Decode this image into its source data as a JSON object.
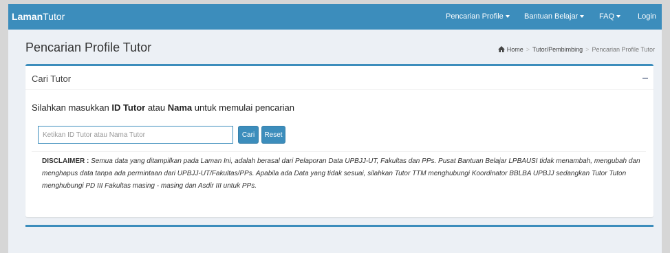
{
  "navbar": {
    "brand_bold": "Laman",
    "brand_rest": "Tutor",
    "items": [
      {
        "label": "Pencarian Profile",
        "dropdown": true
      },
      {
        "label": "Bantuan Belajar",
        "dropdown": true
      },
      {
        "label": "FAQ",
        "dropdown": true
      },
      {
        "label": "Login",
        "dropdown": false
      }
    ]
  },
  "header": {
    "title": "Pencarian Profile Tutor",
    "breadcrumb": [
      "Home",
      "Tutor/Pembimbing",
      "Pencarian Profile Tutor"
    ]
  },
  "box": {
    "title": "Cari Tutor",
    "instruction": {
      "prefix": "Silahkan masukkan ",
      "bold1": "ID Tutor",
      "middle": " atau ",
      "bold2": "Nama",
      "suffix": " untuk memulai pencarian"
    },
    "search": {
      "placeholder": "Ketikan ID Tutor atau Nama Tutor",
      "value": ""
    },
    "buttons": {
      "search": "Cari",
      "reset": "Reset"
    },
    "disclaimer": {
      "label": "DISCLAIMER :",
      "text": "Semua data yang ditampilkan pada Laman Ini, adalah berasal dari Pelaporan Data UPBJJ-UT, Fakultas dan PPs. Pusat Bantuan Belajar LPBAUSI tidak menambah, mengubah dan menghapus data tanpa ada permintaan dari UPBJJ-UT/Fakultas/PPs. Apabila ada Data yang tidak sesuai, silahkan Tutor TTM menghubungi Koordinator BBLBA UPBJJ sedangkan Tutor Tuton menghubungi PD III Fakultas masing - masing dan Asdir III untuk PPs."
    }
  },
  "colors": {
    "primary": "#3c8dbc",
    "background": "#ecf0f5"
  }
}
